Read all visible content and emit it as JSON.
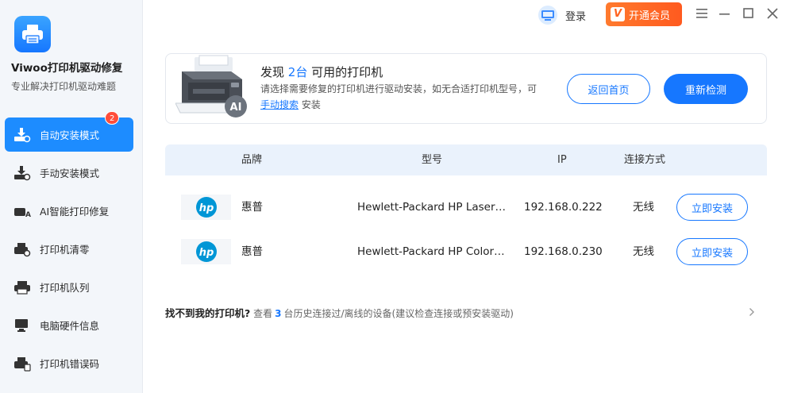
{
  "app": {
    "name": "Viwoo打印机驱动修复",
    "subtitle": "专业解决打印机驱动难题"
  },
  "sidebar": {
    "items": [
      {
        "label": "自动安装模式",
        "icon": "auto-install-icon",
        "active": true,
        "badge": "2"
      },
      {
        "label": "手动安装模式",
        "icon": "manual-install-icon",
        "active": false
      },
      {
        "label": "AI智能打印修复",
        "icon": "ai-repair-icon",
        "active": false
      },
      {
        "label": "打印机清零",
        "icon": "printer-reset-icon",
        "active": false
      },
      {
        "label": "打印机队列",
        "icon": "printer-queue-icon",
        "active": false
      },
      {
        "label": "电脑硬件信息",
        "icon": "hardware-info-icon",
        "active": false
      },
      {
        "label": "打印机错误码",
        "icon": "error-code-icon",
        "active": false
      }
    ]
  },
  "topbar": {
    "login_label": "登录",
    "vip_label": "开通会员",
    "vip_logo": "V"
  },
  "detect": {
    "title_prefix": "发现",
    "count": "2台",
    "title_suffix": "可用的打印机",
    "desc_main": "请选择需要修复的打印机进行驱动安装，如无合适打印机型号，可",
    "desc_link": "手动搜索",
    "desc_tail": "安装",
    "home_button": "返回首页",
    "rescan_button": "重新检测",
    "image_badge": "AI"
  },
  "table": {
    "headers": {
      "brand": "品牌",
      "model": "型号",
      "ip": "IP",
      "connection": "连接方式"
    },
    "rows": [
      {
        "brand": "惠普",
        "model": "Hewlett-Packard HP Laser…",
        "ip": "192.168.0.222",
        "connection": "无线",
        "action": "立即安装",
        "logo": "hp"
      },
      {
        "brand": "惠普",
        "model": "Hewlett-Packard HP Color…",
        "ip": "192.168.0.230",
        "connection": "无线",
        "action": "立即安装",
        "logo": "hp"
      }
    ]
  },
  "hint": {
    "strong": "找不到我的打印机?",
    "pre": "查看",
    "count": "3",
    "post": "台历史连接过/离线的设备(建议检查连接或预安装驱动)"
  },
  "colors": {
    "accent": "#1677ff",
    "vip": "#ff6320",
    "badge": "#ff4d3a",
    "hp": "#0096d6"
  }
}
